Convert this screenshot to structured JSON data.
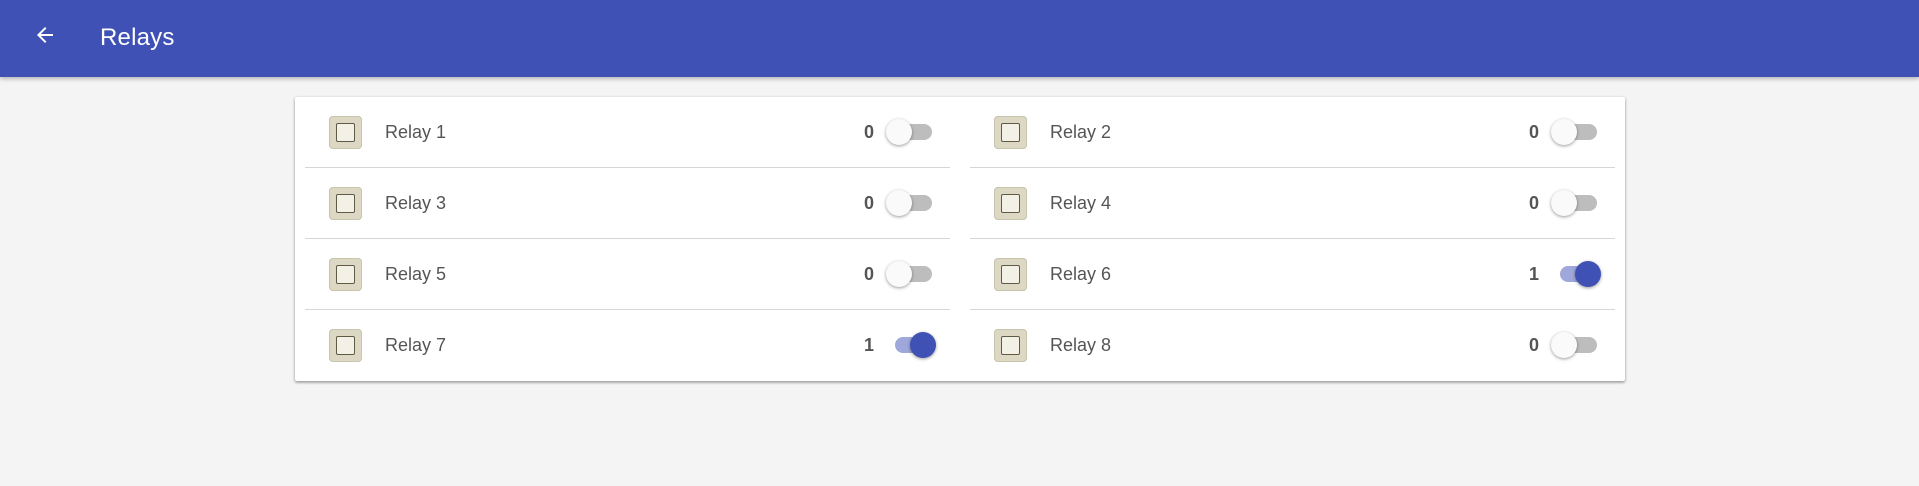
{
  "app_bar": {
    "title": "Relays",
    "back_icon": "arrow-back-icon",
    "color": "#3f51b5"
  },
  "relays_left": [
    {
      "label": "Relay 1",
      "value": "0",
      "state": false
    },
    {
      "label": "Relay 3",
      "value": "0",
      "state": false
    },
    {
      "label": "Relay 5",
      "value": "0",
      "state": false
    },
    {
      "label": "Relay 7",
      "value": "1",
      "state": true
    }
  ],
  "relays_right": [
    {
      "label": "Relay 2",
      "value": "0",
      "state": false
    },
    {
      "label": "Relay 4",
      "value": "0",
      "state": false
    },
    {
      "label": "Relay 6",
      "value": "1",
      "state": true
    },
    {
      "label": "Relay 8",
      "value": "0",
      "state": false
    }
  ],
  "colors": {
    "accent": "#3f51b5",
    "track_on": "#9fa8da",
    "track_off": "#bdbdbd"
  }
}
